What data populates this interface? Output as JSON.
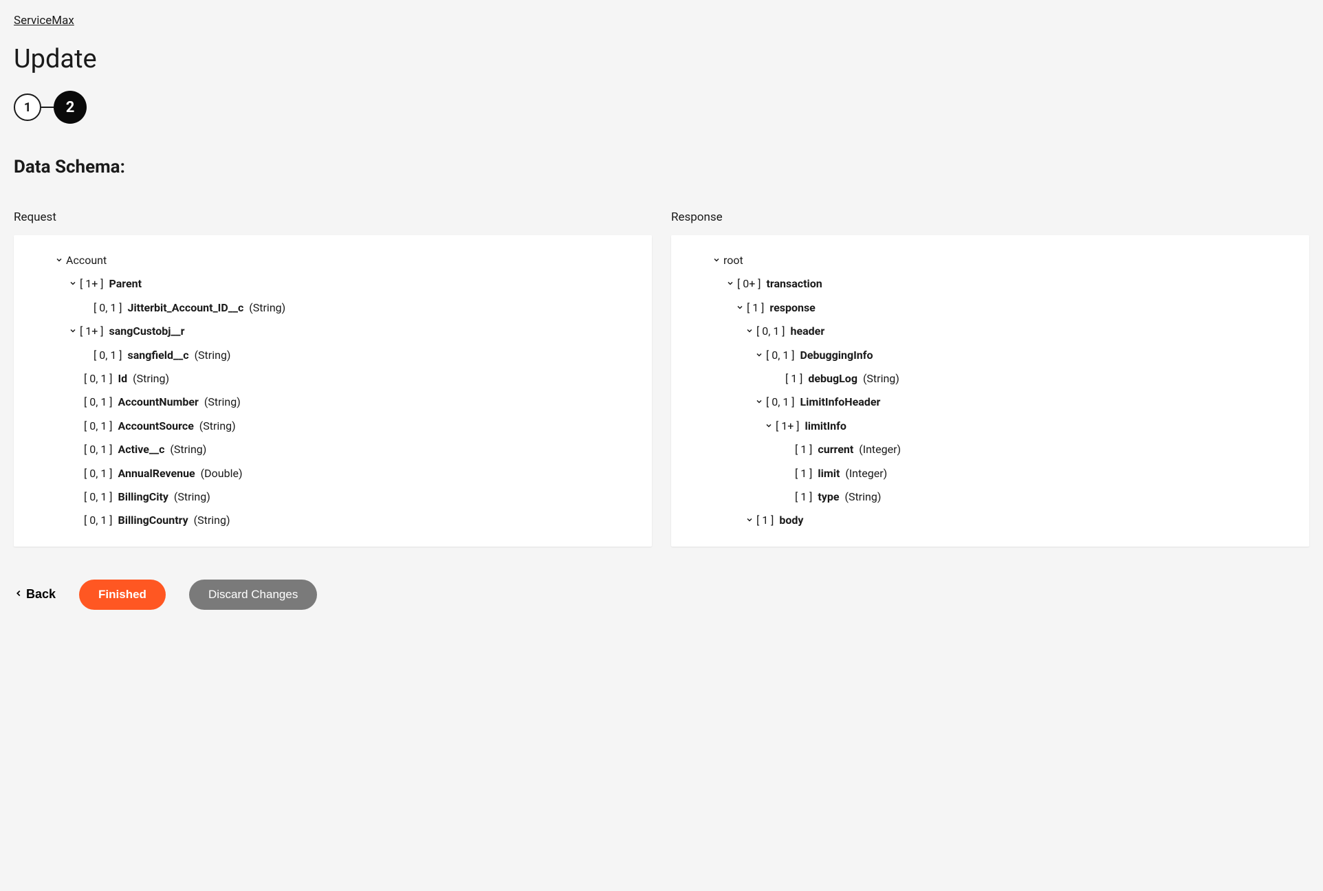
{
  "breadcrumb": "ServiceMax",
  "page_title": "Update",
  "stepper": {
    "step1": "1",
    "step2": "2"
  },
  "section_title": "Data Schema:",
  "request_label": "Request",
  "response_label": "Response",
  "request_tree": [
    {
      "indent": 40,
      "chevron": true,
      "cardinality": "",
      "name": "Account",
      "bold": false,
      "type": ""
    },
    {
      "indent": 60,
      "chevron": true,
      "cardinality": "[ 1+ ] ",
      "name": "Parent",
      "bold": true,
      "type": ""
    },
    {
      "indent": 80,
      "chevron": false,
      "cardinality": "[ 0, 1 ] ",
      "name": "Jitterbit_Account_ID__c",
      "bold": true,
      "type": "(String)"
    },
    {
      "indent": 60,
      "chevron": true,
      "cardinality": "[ 1+ ] ",
      "name": "sangCustobj__r",
      "bold": true,
      "type": ""
    },
    {
      "indent": 80,
      "chevron": false,
      "cardinality": "[ 0, 1 ] ",
      "name": "sangfield__c",
      "bold": true,
      "type": "(String)"
    },
    {
      "indent": 66,
      "chevron": false,
      "cardinality": "[ 0, 1 ] ",
      "name": "Id",
      "bold": true,
      "type": "(String)"
    },
    {
      "indent": 66,
      "chevron": false,
      "cardinality": "[ 0, 1 ] ",
      "name": "AccountNumber",
      "bold": true,
      "type": "(String)"
    },
    {
      "indent": 66,
      "chevron": false,
      "cardinality": "[ 0, 1 ] ",
      "name": "AccountSource",
      "bold": true,
      "type": "(String)"
    },
    {
      "indent": 66,
      "chevron": false,
      "cardinality": "[ 0, 1 ] ",
      "name": "Active__c",
      "bold": true,
      "type": "(String)"
    },
    {
      "indent": 66,
      "chevron": false,
      "cardinality": "[ 0, 1 ] ",
      "name": "AnnualRevenue",
      "bold": true,
      "type": "(Double)"
    },
    {
      "indent": 66,
      "chevron": false,
      "cardinality": "[ 0, 1 ] ",
      "name": "BillingCity",
      "bold": true,
      "type": "(String)"
    },
    {
      "indent": 66,
      "chevron": false,
      "cardinality": "[ 0, 1 ] ",
      "name": "BillingCountry",
      "bold": true,
      "type": "(String)"
    }
  ],
  "response_tree": [
    {
      "indent": 40,
      "chevron": true,
      "cardinality": "",
      "name": "root",
      "bold": false,
      "type": ""
    },
    {
      "indent": 60,
      "chevron": true,
      "cardinality": "[ 0+ ] ",
      "name": "transaction",
      "bold": true,
      "type": ""
    },
    {
      "indent": 74,
      "chevron": true,
      "cardinality": "[ 1 ] ",
      "name": "response",
      "bold": true,
      "type": ""
    },
    {
      "indent": 88,
      "chevron": true,
      "cardinality": "[ 0, 1 ] ",
      "name": "header",
      "bold": true,
      "type": ""
    },
    {
      "indent": 102,
      "chevron": true,
      "cardinality": "[ 0, 1 ] ",
      "name": "DebuggingInfo",
      "bold": true,
      "type": ""
    },
    {
      "indent": 130,
      "chevron": false,
      "cardinality": "[ 1 ] ",
      "name": "debugLog",
      "bold": true,
      "type": "(String)"
    },
    {
      "indent": 102,
      "chevron": true,
      "cardinality": "[ 0, 1 ] ",
      "name": "LimitInfoHeader",
      "bold": true,
      "type": ""
    },
    {
      "indent": 116,
      "chevron": true,
      "cardinality": "[ 1+ ] ",
      "name": "limitInfo",
      "bold": true,
      "type": ""
    },
    {
      "indent": 144,
      "chevron": false,
      "cardinality": "[ 1 ] ",
      "name": "current",
      "bold": true,
      "type": "(Integer)"
    },
    {
      "indent": 144,
      "chevron": false,
      "cardinality": "[ 1 ] ",
      "name": "limit",
      "bold": true,
      "type": "(Integer)"
    },
    {
      "indent": 144,
      "chevron": false,
      "cardinality": "[ 1 ] ",
      "name": "type",
      "bold": true,
      "type": "(String)"
    },
    {
      "indent": 88,
      "chevron": true,
      "cardinality": "[ 1 ] ",
      "name": "body",
      "bold": true,
      "type": ""
    }
  ],
  "footer": {
    "back": "Back",
    "finished": "Finished",
    "discard": "Discard Changes"
  }
}
